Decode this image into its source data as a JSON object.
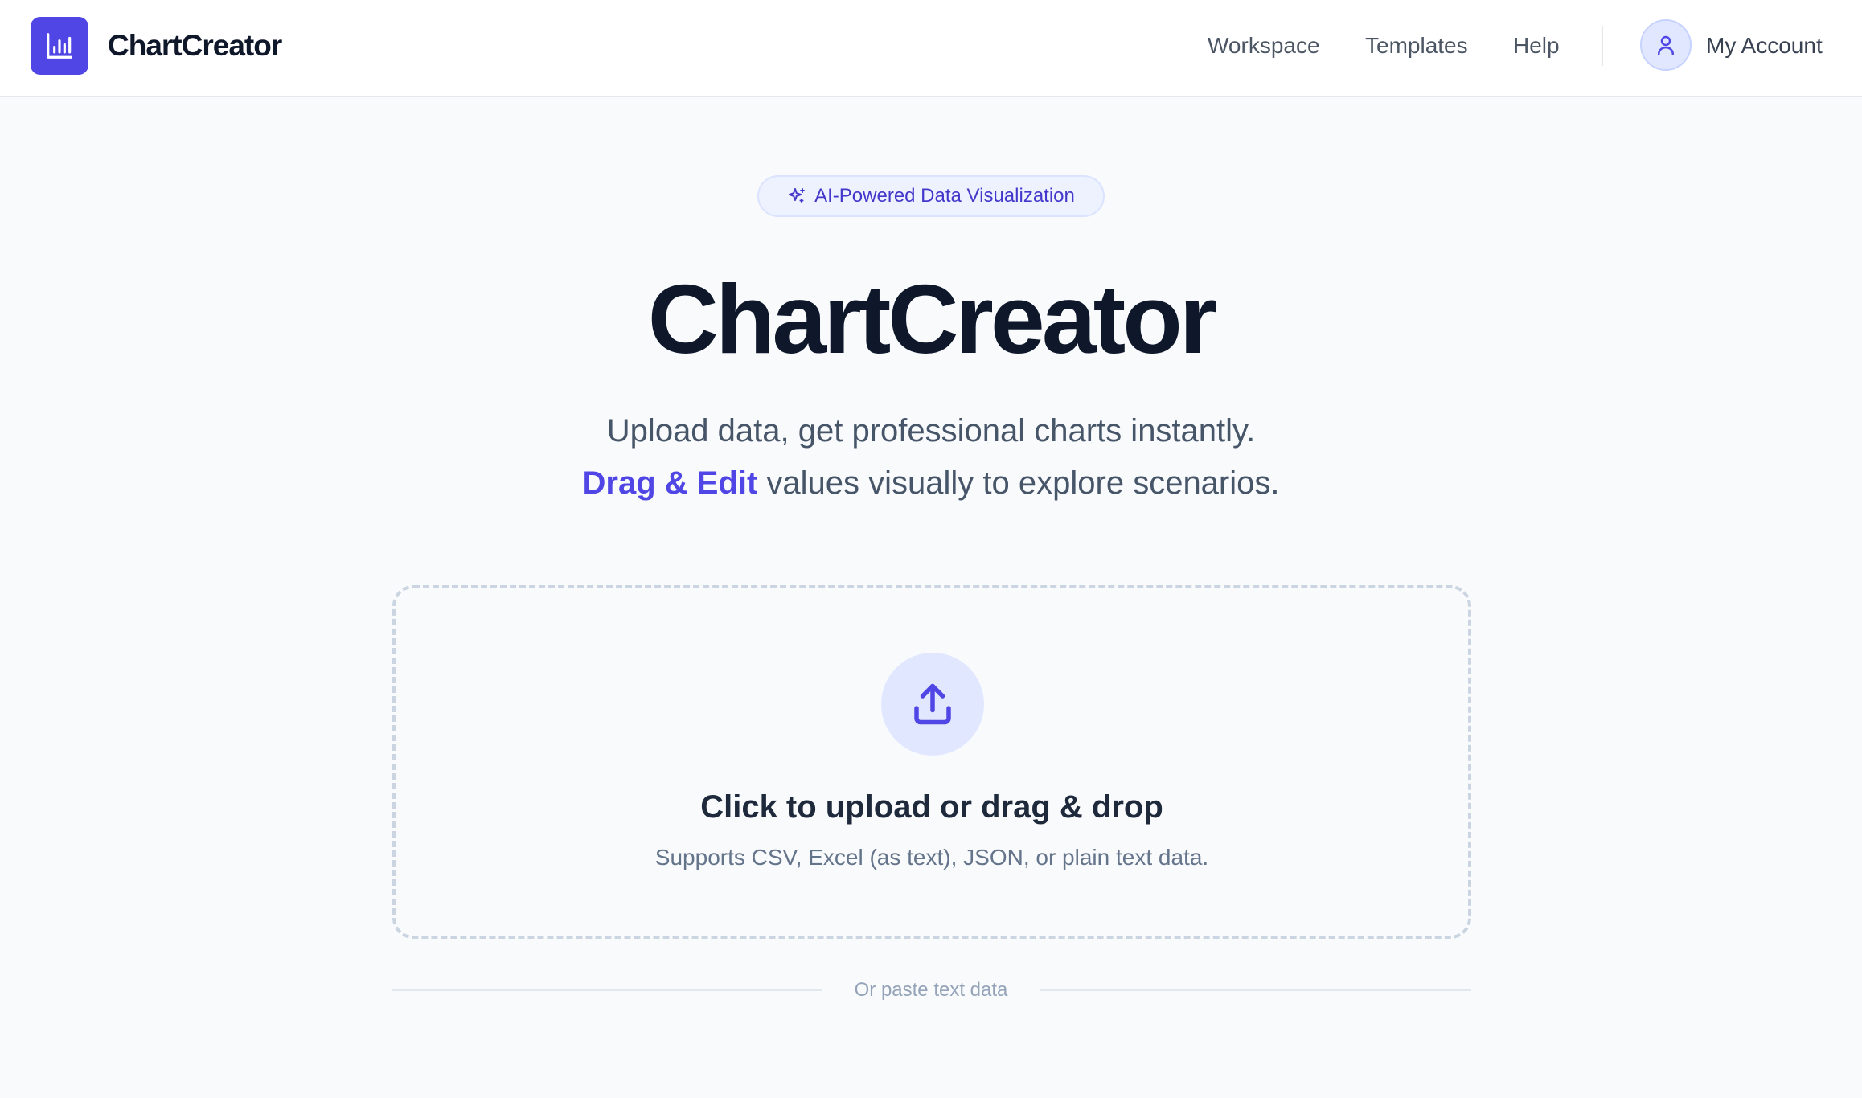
{
  "header": {
    "brand": "ChartCreator",
    "logo_icon": "bar-chart-icon",
    "nav": [
      {
        "label": "Workspace"
      },
      {
        "label": "Templates"
      },
      {
        "label": "Help"
      }
    ],
    "account_label": "My Account",
    "account_icon": "user-icon"
  },
  "hero": {
    "badge_icon": "sparkles-icon",
    "badge": "AI-Powered Data Visualization",
    "title": "ChartCreator",
    "subtitle": "Upload data, get professional charts instantly.",
    "subtitle2_accent": "Drag & Edit",
    "subtitle2_rest": " values visually to explore scenarios."
  },
  "upload": {
    "icon": "upload-icon",
    "title": "Click to upload or drag & drop",
    "subtitle": "Supports CSV, Excel (as text), JSON, or plain text data."
  },
  "separator": {
    "label": "Or paste text data"
  },
  "colors": {
    "accent": "#4f46e5",
    "accent_light": "#e0e7ff",
    "background": "#f8fafc",
    "text_primary": "#0f172a",
    "text_muted": "#64748b"
  }
}
